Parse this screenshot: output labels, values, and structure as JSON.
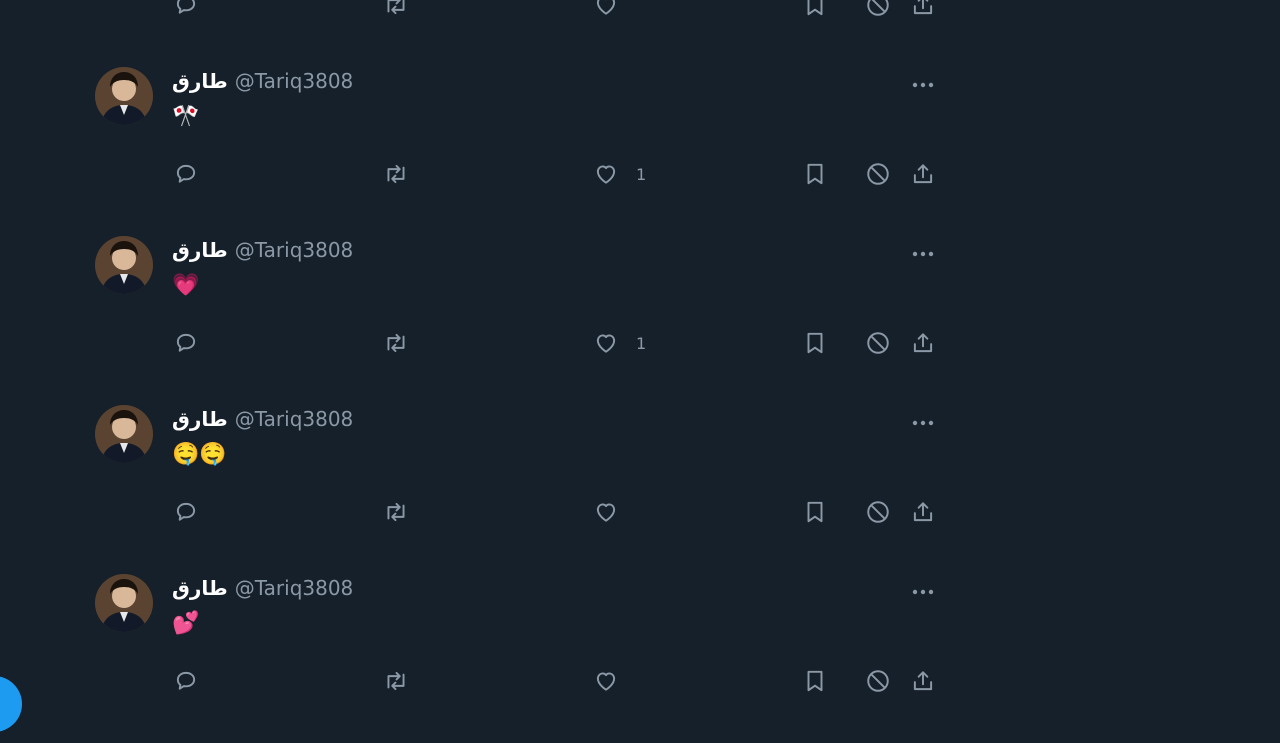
{
  "timeline": {
    "top_partial_actions": {
      "reply_icon": "reply-icon",
      "retweet_icon": "retweet-icon",
      "like_icon": "heart-icon",
      "bookmark_icon": "bookmark-icon",
      "block_icon": "block-icon",
      "share_icon": "share-icon"
    },
    "tweets": [
      {
        "display_name": "طارق",
        "handle": "@Tariq3808",
        "text": "🎌",
        "like_count": "1"
      },
      {
        "display_name": "طارق",
        "handle": "@Tariq3808",
        "text": "💗",
        "like_count": "1"
      },
      {
        "display_name": "طارق",
        "handle": "@Tariq3808",
        "text": "🤤🤤",
        "like_count": ""
      },
      {
        "display_name": "طارق",
        "handle": "@Tariq3808",
        "text": "💕",
        "like_count": ""
      }
    ]
  },
  "colors": {
    "background": "#15202b",
    "primary_text": "#ffffff",
    "secondary_text": "#8b98a5",
    "accent": "#1d9bf0"
  }
}
